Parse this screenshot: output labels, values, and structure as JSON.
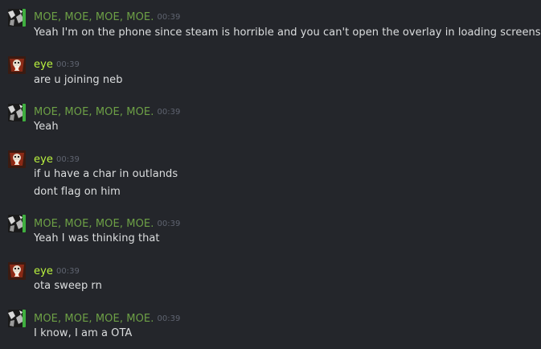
{
  "messages": [
    {
      "sender": "MOE, MOE, MOE, MOE.",
      "time": "00:39",
      "avatar": "moe-avatar",
      "lines": [
        "Yeah I'm on the phone since steam is horrible and you can't open the overlay in loading screens"
      ]
    },
    {
      "sender": "eye",
      "time": "00:39",
      "avatar": "eye-avatar",
      "lines": [
        "are u joining neb"
      ]
    },
    {
      "sender": "MOE, MOE, MOE, MOE.",
      "time": "00:39",
      "avatar": "moe-avatar",
      "lines": [
        "Yeah"
      ]
    },
    {
      "sender": "eye",
      "time": "00:39",
      "avatar": "eye-avatar",
      "lines": [
        "if u have a char in outlands",
        "dont flag on him"
      ]
    },
    {
      "sender": "MOE, MOE, MOE, MOE.",
      "time": "00:39",
      "avatar": "moe-avatar",
      "lines": [
        "Yeah I was thinking that"
      ]
    },
    {
      "sender": "eye",
      "time": "00:39",
      "avatar": "eye-avatar",
      "lines": [
        "ota sweep rn"
      ]
    },
    {
      "sender": "MOE, MOE, MOE, MOE.",
      "time": "00:39",
      "avatar": "moe-avatar",
      "lines": [
        "I know, I am a OTA"
      ]
    }
  ],
  "colors": {
    "background": "#24262b",
    "moe_name": "#6da046",
    "eye_name": "#bcf53f",
    "timestamp": "#5f6470",
    "message_text": "#dcdedf"
  }
}
